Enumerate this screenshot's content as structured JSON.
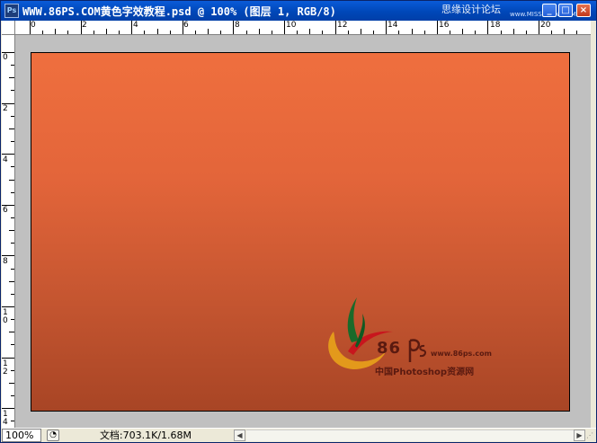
{
  "window": {
    "app_icon_label": "Ps",
    "title": "WWW.86PS.COM黄色字效教程.psd @ 100% (图层 1, RGB/8)",
    "watermark": "思缘设计论坛",
    "watermark_url": "www.MISSYUAN.COM",
    "minimize_label": "_",
    "maximize_label": "□",
    "close_label": "×"
  },
  "ruler": {
    "horizontal_labels": [
      "0",
      "2",
      "4",
      "6",
      "8",
      "10",
      "12",
      "14",
      "16",
      "18",
      "20"
    ],
    "vertical_labels": [
      "0",
      "2",
      "4",
      "6",
      "8",
      "10",
      "12",
      "14"
    ]
  },
  "canvas": {
    "gradient_top": "#ef6f3e",
    "gradient_bottom": "#a84525",
    "logo": {
      "number": "86",
      "url": "www.86ps.com",
      "tagline": "中国Photoshop资源网"
    }
  },
  "status": {
    "zoom": "100%",
    "doc_info": "文档:703.1K/1.68M",
    "nav_left": "◀",
    "nav_right": "▶"
  },
  "colors": {
    "titlebar": "#0a5bd8",
    "workspace": "#c0c0c0"
  }
}
